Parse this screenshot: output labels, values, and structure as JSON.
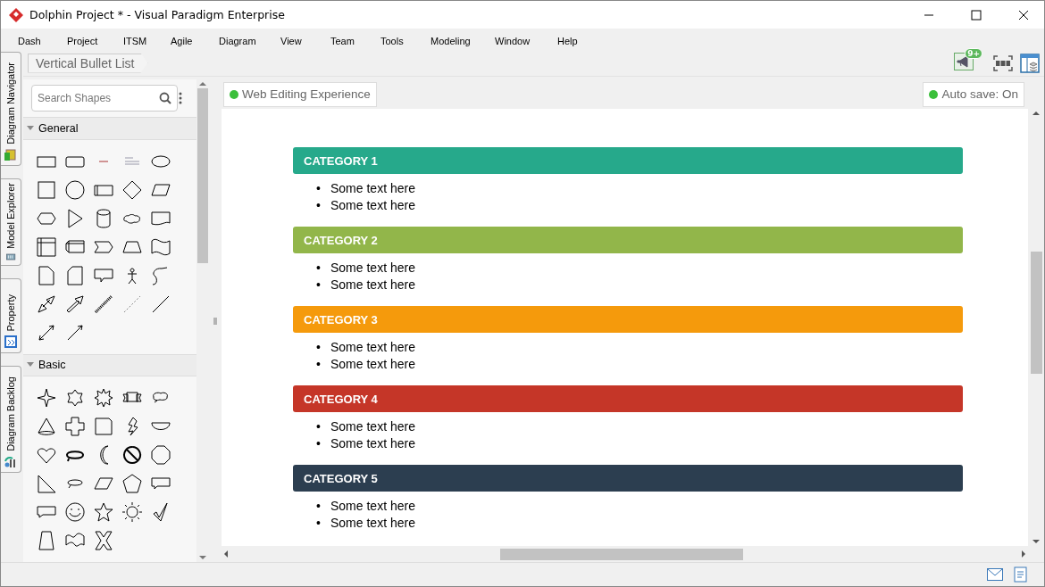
{
  "window": {
    "title": "Dolphin Project * - Visual Paradigm Enterprise"
  },
  "menu": [
    "Dash",
    "Project",
    "ITSM",
    "Agile",
    "Diagram",
    "View",
    "Team",
    "Tools",
    "Modeling",
    "Window",
    "Help"
  ],
  "side_tabs": [
    {
      "label": "Diagram Navigator"
    },
    {
      "label": "Model Explorer"
    },
    {
      "label": "Property"
    },
    {
      "label": "Diagram Backlog"
    }
  ],
  "breadcrumb": "Vertical Bullet List",
  "notification_badge": "9+",
  "palette": {
    "search": {
      "placeholder": "Search Shapes"
    },
    "sections": [
      {
        "title": "General",
        "expanded": true
      },
      {
        "title": "Basic",
        "expanded": true
      }
    ]
  },
  "canvas_toolbar": {
    "web_editing": "Web Editing Experience",
    "auto_save": "Auto save: On"
  },
  "categories": [
    {
      "title": "CATEGORY 1",
      "color": "#26a98b",
      "items": [
        {
          "bullet": "•",
          "text": "Some text here"
        },
        {
          "bullet": "•",
          "text": "Some text here"
        }
      ]
    },
    {
      "title": "CATEGORY 2",
      "color": "#92b64a",
      "items": [
        {
          "bullet": "•",
          "text": "Some text here"
        },
        {
          "bullet": "•",
          "text": "Some text here"
        }
      ]
    },
    {
      "title": "CATEGORY 3",
      "color": "#f59a0c",
      "items": [
        {
          "bullet": "•",
          "text": "Some text here"
        },
        {
          "bullet": "•",
          "text": "Some text here"
        }
      ]
    },
    {
      "title": "CATEGORY 4",
      "color": "#c53628",
      "items": [
        {
          "bullet": "•",
          "text": "Some text here"
        },
        {
          "bullet": "•",
          "text": "Some text here"
        }
      ]
    },
    {
      "title": "CATEGORY 5",
      "color": "#2c3e50",
      "items": [
        {
          "bullet": "•",
          "text": "Some text here"
        },
        {
          "bullet": "•",
          "text": "Some text here"
        }
      ]
    }
  ]
}
